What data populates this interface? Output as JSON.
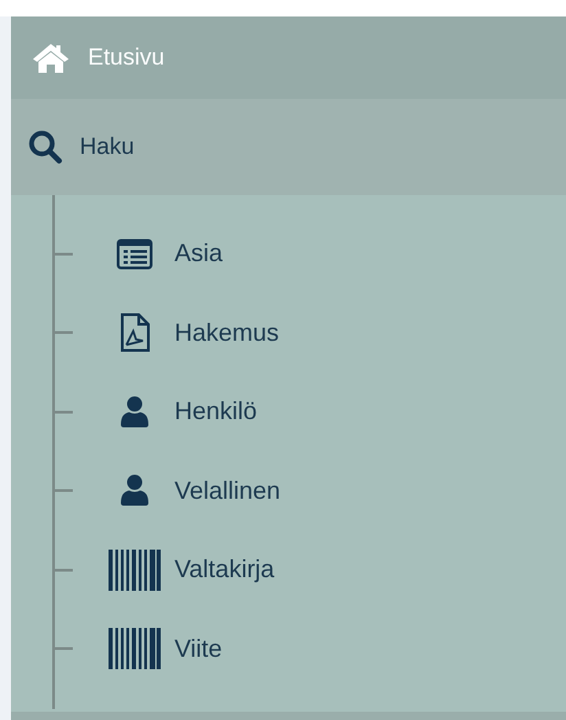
{
  "nav": [
    {
      "label": "Etusivu",
      "kind": "home"
    },
    {
      "label": "Haku",
      "kind": "search"
    }
  ],
  "items": [
    {
      "label": "Asia",
      "kind": "list"
    },
    {
      "label": "Hakemus",
      "kind": "pdf"
    },
    {
      "label": "Henkilö",
      "kind": "user"
    },
    {
      "label": "Velallinen",
      "kind": "user"
    },
    {
      "label": "Valtakirja",
      "kind": "barcode"
    },
    {
      "label": "Viite",
      "kind": "barcode"
    }
  ]
}
